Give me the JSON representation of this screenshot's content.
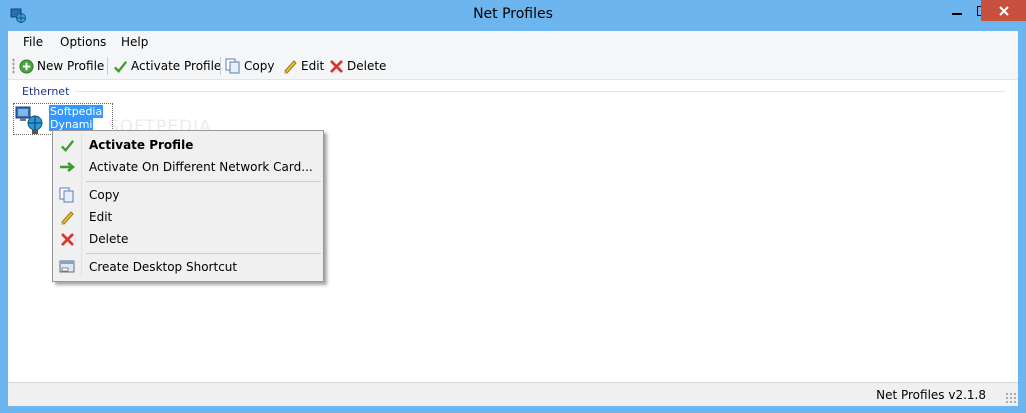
{
  "window": {
    "title": "Net Profiles",
    "close_glyph": "✕",
    "min_glyph": "—",
    "max_glyph": "☐"
  },
  "menu": {
    "items": [
      "File",
      "Options",
      "Help"
    ]
  },
  "toolbar": {
    "new_profile": "New Profile",
    "activate_profile": "Activate Profile",
    "copy": "Copy",
    "edit": "Edit",
    "delete": "Delete"
  },
  "list": {
    "group": "Ethernet",
    "item_line1": "Softpedia",
    "item_line2": "Dynami"
  },
  "watermark": "SOFTPEDIA",
  "context_menu": {
    "activate_profile": "Activate Profile",
    "activate_different": "Activate On Different Network Card...",
    "copy": "Copy",
    "edit": "Edit",
    "delete": "Delete",
    "shortcut": "Create Desktop Shortcut"
  },
  "status": {
    "version": "Net Profiles v2.1.8"
  },
  "colors": {
    "title_bg": "#6db5ef",
    "close_red": "#c7503e",
    "selection": "#3399ff",
    "group_header": "#1e3287"
  }
}
